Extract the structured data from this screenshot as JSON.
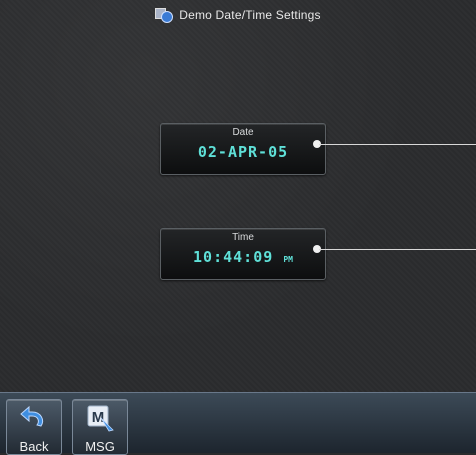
{
  "header": {
    "title": "Demo Date/Time Settings",
    "icon": "settings-window-icon"
  },
  "date_field": {
    "label": "Date",
    "value": "02-APR-05"
  },
  "time_field": {
    "label": "Time",
    "value": "10:44:09",
    "ampm": "PM"
  },
  "bottom_bar": {
    "back_label": "Back",
    "back_icon": "back-arrow-icon",
    "msg_label": "MSG",
    "msg_icon": "message-icon",
    "msg_icon_letter": "M"
  },
  "colors": {
    "value_text": "#5fe0d8",
    "background": "#2b2c2e",
    "bottom_bar": "#2f3a45"
  }
}
